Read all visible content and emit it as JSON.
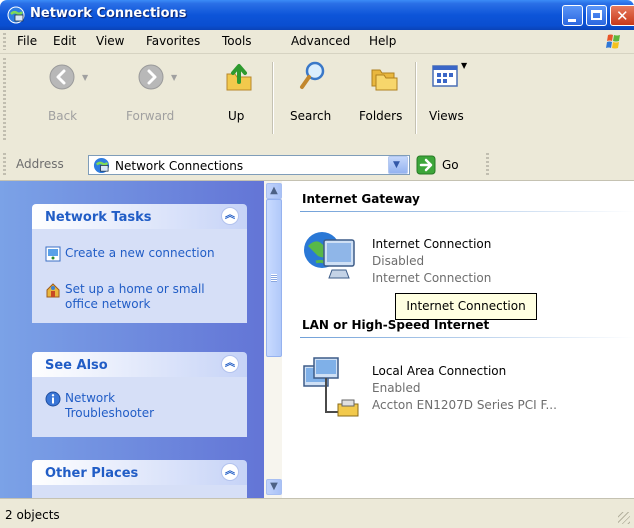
{
  "window": {
    "title": "Network Connections",
    "titlebar_color": "#0a4ed0",
    "controls": [
      "minimize-icon",
      "maximize-icon",
      "close-icon"
    ]
  },
  "menubar": {
    "items": [
      {
        "label": "File",
        "icon": null
      },
      {
        "label": "Edit"
      },
      {
        "label": "View"
      },
      {
        "label": "Favorites"
      },
      {
        "label": "Tools"
      },
      {
        "label": "Advanced"
      },
      {
        "label": "Help"
      }
    ]
  },
  "toolbar": {
    "back": {
      "label": "Back",
      "icon": "back-arrow-icon",
      "enabled": false
    },
    "forward": {
      "label": "Forward",
      "icon": "forward-arrow-icon",
      "enabled": false
    },
    "up": {
      "label": "Up",
      "icon": "up-folder-icon"
    },
    "search": {
      "label": "Search",
      "icon": "search-icon"
    },
    "folders": {
      "label": "Folders",
      "icon": "folders-icon"
    },
    "views": {
      "label": "Views",
      "icon": "views-icon"
    }
  },
  "address": {
    "label": "Address",
    "value": "Network Connections",
    "go_label": "Go"
  },
  "taskpane": {
    "network_tasks": {
      "title": "Network Tasks",
      "items": [
        {
          "label": "Create a new connection",
          "icon": "new-connection-icon"
        },
        {
          "label": "Set up a home or small office network",
          "icon": "home-network-icon"
        }
      ]
    },
    "see_also": {
      "title": "See Also",
      "items": [
        {
          "label": "Network Troubleshooter",
          "icon": "info-icon"
        }
      ]
    },
    "other_places": {
      "title": "Other Places"
    }
  },
  "content": {
    "groups": [
      {
        "title": "Internet Gateway",
        "items": [
          {
            "name": "Internet Connection",
            "status": "Disabled",
            "detail": "Internet Connection",
            "icon": "internet-gateway-icon"
          }
        ]
      },
      {
        "title": "LAN or High-Speed Internet",
        "items": [
          {
            "name": "Local Area Connection",
            "status": "Enabled",
            "detail": "Accton EN1207D Series PCI F...",
            "icon": "lan-connection-icon"
          }
        ]
      }
    ],
    "tooltip": "Internet Connection"
  },
  "statusbar": {
    "text": "2 objects"
  },
  "colors": {
    "taskpane_gradient_start": "#7ba2e7",
    "taskpane_gradient_end": "#6375d6",
    "task_link": "#215dc6",
    "chrome": "#ece9d8"
  }
}
